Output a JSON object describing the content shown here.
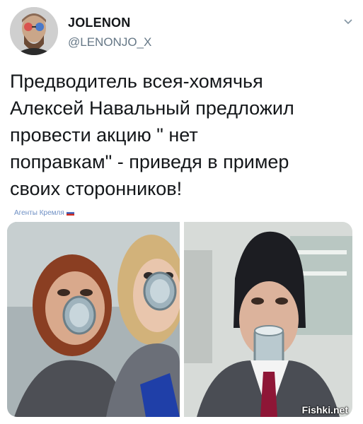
{
  "tweet": {
    "display_name": "JOLENON",
    "handle": "@LENONJO_X",
    "text": "Предводитель всея-хомячья\nАлексей Навальный предложил\nпровести акцию \" нет\nпоправкам\"  - приведя в пример\nсвоих сторонников!"
  },
  "icons": {
    "more": "chevron-down-icon",
    "flag": "russian-flag-icon"
  },
  "watermarks": {
    "agents": "Агенты Кремля",
    "site": "Fishki.net"
  },
  "colors": {
    "text": "#14171a",
    "handle": "#657786",
    "watermark": "#6e8fc4"
  }
}
